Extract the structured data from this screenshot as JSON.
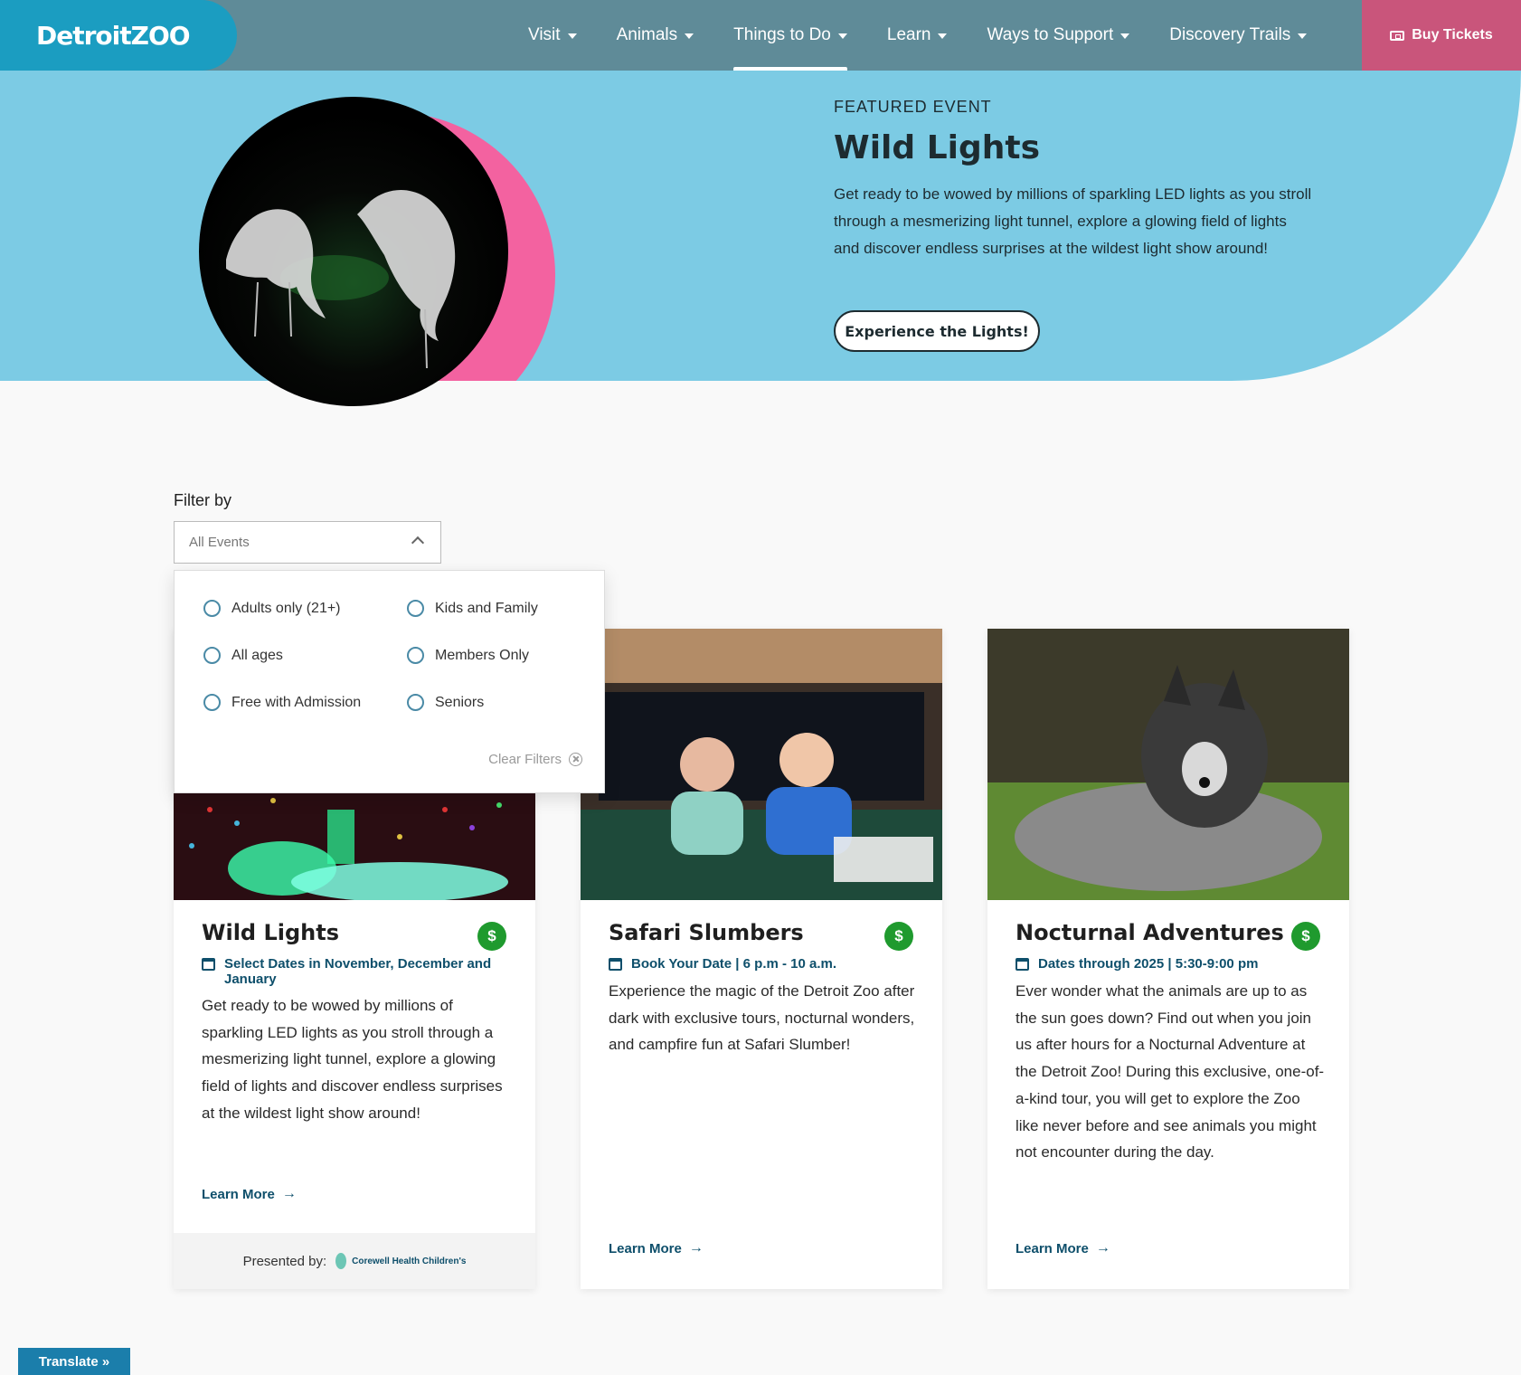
{
  "nav": {
    "logo": "DetroitZOO",
    "items": [
      {
        "label": "Visit"
      },
      {
        "label": "Animals"
      },
      {
        "label": "Things to Do"
      },
      {
        "label": "Learn"
      },
      {
        "label": "Ways to Support"
      },
      {
        "label": "Discovery Trails"
      }
    ],
    "active_item": "Things to Do",
    "buy_tickets": "Buy Tickets"
  },
  "hero": {
    "eyebrow": "FEATURED EVENT",
    "title": "Wild Lights",
    "description": "Get ready to be wowed by millions of sparkling LED lights as you stroll through a mesmerizing light tunnel, explore a glowing field of lights and discover endless surprises at the wildest light show around!",
    "button": "Experience the Lights!"
  },
  "filter": {
    "label": "Filter by",
    "selected": "All Events",
    "options": [
      "Adults only (21+)",
      "Kids and Family",
      "All ages",
      "Members Only",
      "Free with Admission",
      "Seniors"
    ],
    "clear": "Clear Filters"
  },
  "cards": [
    {
      "title": "Wild Lights",
      "badge": "$",
      "date": "Select Dates in November, December and January",
      "description": "Get ready to be wowed by millions of sparkling LED lights as you stroll through a mesmerizing light tunnel, explore a glowing field of lights and discover endless surprises at the wildest light show around!",
      "link": "Learn More",
      "presented_by": "Presented by:",
      "sponsor": "Corewell Health Children's"
    },
    {
      "title": "Safari Slumbers",
      "badge": "$",
      "date": "Book Your Date | 6 p.m - 10 a.m.",
      "description": "Experience the magic of the Detroit Zoo after dark with exclusive tours, nocturnal wonders, and campfire fun at Safari Slumber!",
      "link": "Learn More"
    },
    {
      "title": "Nocturnal Adventures",
      "badge": "$",
      "date": "Dates through 2025 | 5:30-9:00 pm",
      "description": "Ever wonder what the animals are up to as the sun goes down? Find out when you join us after hours for a Nocturnal Adventure at the Detroit Zoo! During this exclusive, one-of-a-kind tour, you will get to explore the Zoo like never before and see animals you might not encounter during the day.",
      "link": "Learn More"
    }
  ],
  "translate": "Translate »",
  "colors": {
    "nav_bg": "#5f8b98",
    "logo_bg": "#1b9dc1",
    "buy_bg": "#c9557b",
    "hero_bg": "#7ccbe4",
    "hero_accent": "#f362a0",
    "badge_green": "#1f9a2e",
    "link": "#0e4f6b"
  }
}
